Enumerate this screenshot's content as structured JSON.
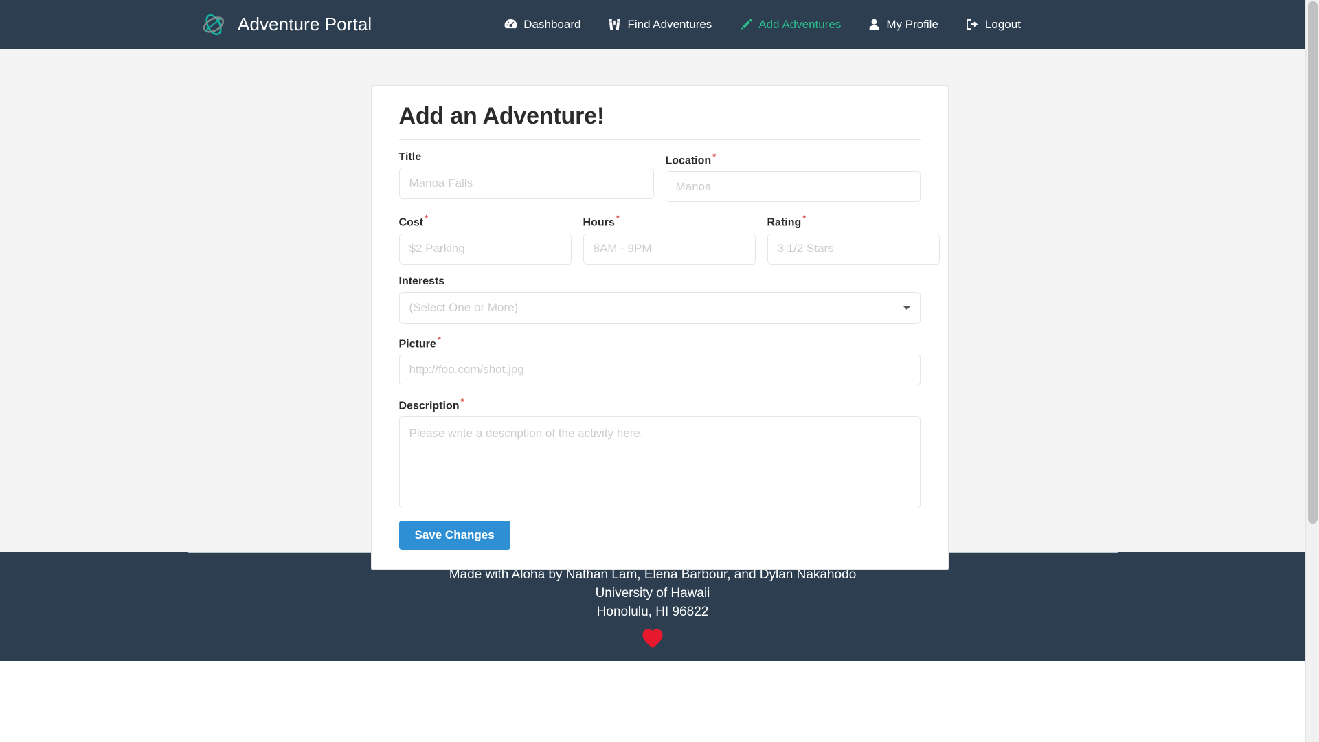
{
  "brand": {
    "name": "Adventure Portal",
    "logo_icon": "orbit-atom-logo",
    "logo_color_primary": "#17b3a3",
    "logo_color_secondary": "#7f8c8d"
  },
  "nav": {
    "items": [
      {
        "label": "Dashboard",
        "icon": "tachometer-icon",
        "active": false
      },
      {
        "label": "Find Adventures",
        "icon": "binoculars-icon",
        "active": false
      },
      {
        "label": "Add Adventures",
        "icon": "pencil-icon",
        "active": true
      },
      {
        "label": "My Profile",
        "icon": "user-icon",
        "active": false
      },
      {
        "label": "Logout",
        "icon": "sign-out-icon",
        "active": false
      }
    ],
    "active_color": "#2bbd8c",
    "background": "#2c3e50"
  },
  "card": {
    "title": "Add an Adventure!"
  },
  "form": {
    "required_marker": "*",
    "fields": {
      "title": {
        "label": "Title",
        "required": false,
        "placeholder": "Manoa Falls",
        "value": ""
      },
      "location": {
        "label": "Location",
        "required": true,
        "placeholder": "Manoa",
        "value": ""
      },
      "cost": {
        "label": "Cost",
        "required": true,
        "placeholder": "$2 Parking",
        "value": ""
      },
      "hours": {
        "label": "Hours",
        "required": true,
        "placeholder": "8AM - 9PM",
        "value": ""
      },
      "rating": {
        "label": "Rating",
        "required": true,
        "placeholder": "3 1/2 Stars",
        "value": ""
      },
      "interests": {
        "label": "Interests",
        "required": false,
        "placeholder": "(Select One or More)",
        "value": ""
      },
      "picture": {
        "label": "Picture",
        "required": true,
        "placeholder": "http://foo.com/shot.jpg",
        "value": ""
      },
      "description": {
        "label": "Description",
        "required": true,
        "placeholder": "Please write a description of the activity here.",
        "value": ""
      }
    },
    "submit": {
      "label": "Save Changes",
      "color": "#2f8fd4"
    }
  },
  "footer": {
    "line1": "Made with Aloha by Nathan Lam, Elena Barbour, and Dylan Nakahodo",
    "line2": "University of Hawaii",
    "line3": "Honolulu, HI 96822",
    "heart_icon": "heart-icon",
    "heart_color": "#e8192c"
  }
}
